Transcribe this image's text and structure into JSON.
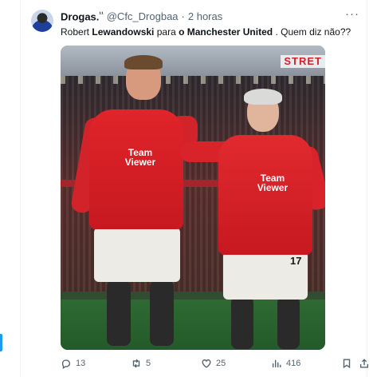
{
  "tweet": {
    "display_name": "Drogas.",
    "name_badge": "¹¹",
    "handle": "@Cfc_Drogbaa",
    "separator": "·",
    "time": "2 horas",
    "text_parts": {
      "p1": "Robert ",
      "p2": "Lewandowski",
      "p3": " para ",
      "p4": "o Manchester United",
      "p5": " . Quem diz não??"
    },
    "media": {
      "stand_sign": "STRET",
      "sponsor_line1": "Team",
      "sponsor_line2": "Viewer",
      "shirt_number": "17"
    },
    "actions": {
      "replies": "13",
      "retweets": "5",
      "likes": "25",
      "views": "416"
    },
    "icons": [
      "avatar",
      "more-icon",
      "reply-icon",
      "retweet-icon",
      "like-icon",
      "views-icon",
      "bookmark-icon",
      "share-icon"
    ]
  }
}
